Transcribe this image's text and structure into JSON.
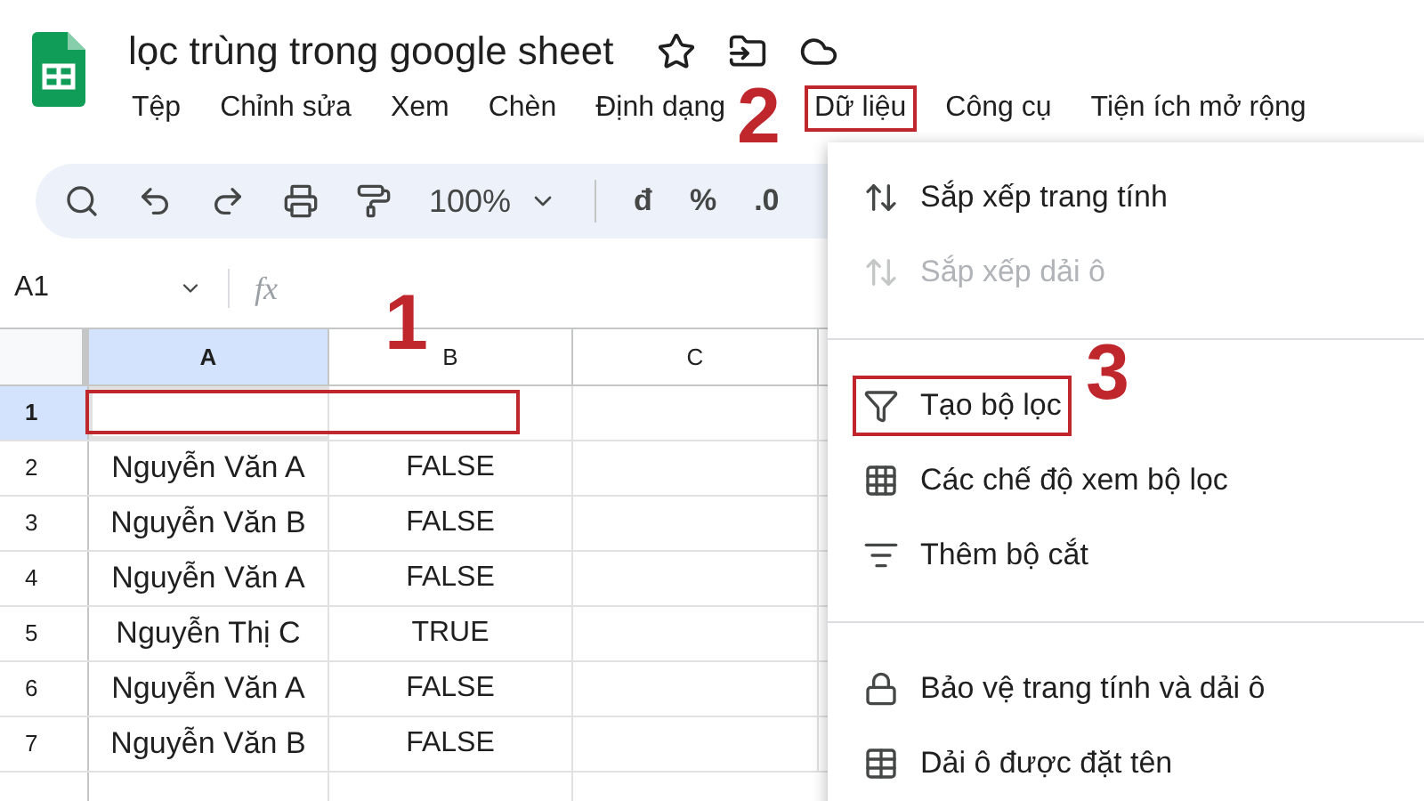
{
  "document": {
    "title": "lọc trùng trong google sheet"
  },
  "menu_bar": [
    {
      "label": "Tệp",
      "annotated": false
    },
    {
      "label": "Chỉnh sửa",
      "annotated": false
    },
    {
      "label": "Xem",
      "annotated": false
    },
    {
      "label": "Chèn",
      "annotated": false
    },
    {
      "label": "Định dạng",
      "annotated": false
    },
    {
      "label": "Dữ liệu",
      "annotated": true
    },
    {
      "label": "Công cụ",
      "annotated": false
    },
    {
      "label": "Tiện ích mở rộng",
      "annotated": false
    }
  ],
  "toolbar": {
    "zoom": "100%",
    "format_buttons": [
      "đ",
      "%",
      ".0"
    ]
  },
  "formula_bar": {
    "cell": "A1",
    "fx": "fx"
  },
  "sheet": {
    "columns": [
      {
        "label": "A",
        "selected": true
      },
      {
        "label": "B",
        "selected": false
      },
      {
        "label": "C",
        "selected": false
      }
    ],
    "rows": [
      {
        "number": "1",
        "selected": true,
        "annotated": true
      },
      {
        "number": "2",
        "selected": false,
        "name": "Nguyễn Văn A",
        "value": "FALSE"
      },
      {
        "number": "3",
        "selected": false,
        "name": "Nguyễn Văn B",
        "value": "FALSE"
      },
      {
        "number": "4",
        "selected": false,
        "name": "Nguyễn Văn A",
        "value": "FALSE"
      },
      {
        "number": "5",
        "selected": false,
        "name": "Nguyễn Thị C",
        "value": "TRUE"
      },
      {
        "number": "6",
        "selected": false,
        "name": "Nguyễn Văn A",
        "value": "FALSE"
      },
      {
        "number": "7",
        "selected": false,
        "name": "Nguyễn Văn B",
        "value": "FALSE"
      }
    ]
  },
  "data_menu": [
    {
      "kind": "item",
      "label": "Sắp xếp trang tính",
      "disabled": false,
      "annotated": false
    },
    {
      "kind": "item",
      "label": "Sắp xếp dải ô",
      "disabled": true,
      "annotated": false
    },
    {
      "kind": "separator"
    },
    {
      "kind": "item",
      "label": "Tạo bộ lọc",
      "disabled": false,
      "annotated": true
    },
    {
      "kind": "item",
      "label": "Các chế độ xem bộ lọc",
      "disabled": false,
      "annotated": false
    },
    {
      "kind": "item",
      "label": "Thêm bộ cắt",
      "disabled": false,
      "annotated": false
    },
    {
      "kind": "separator"
    },
    {
      "kind": "item",
      "label": "Bảo vệ trang tính và dải ô",
      "disabled": false,
      "annotated": false
    },
    {
      "kind": "item",
      "label": "Dải ô được đặt tên",
      "disabled": false,
      "annotated": false
    }
  ],
  "callouts": [
    {
      "number": "1"
    },
    {
      "number": "2"
    },
    {
      "number": "3"
    }
  ]
}
